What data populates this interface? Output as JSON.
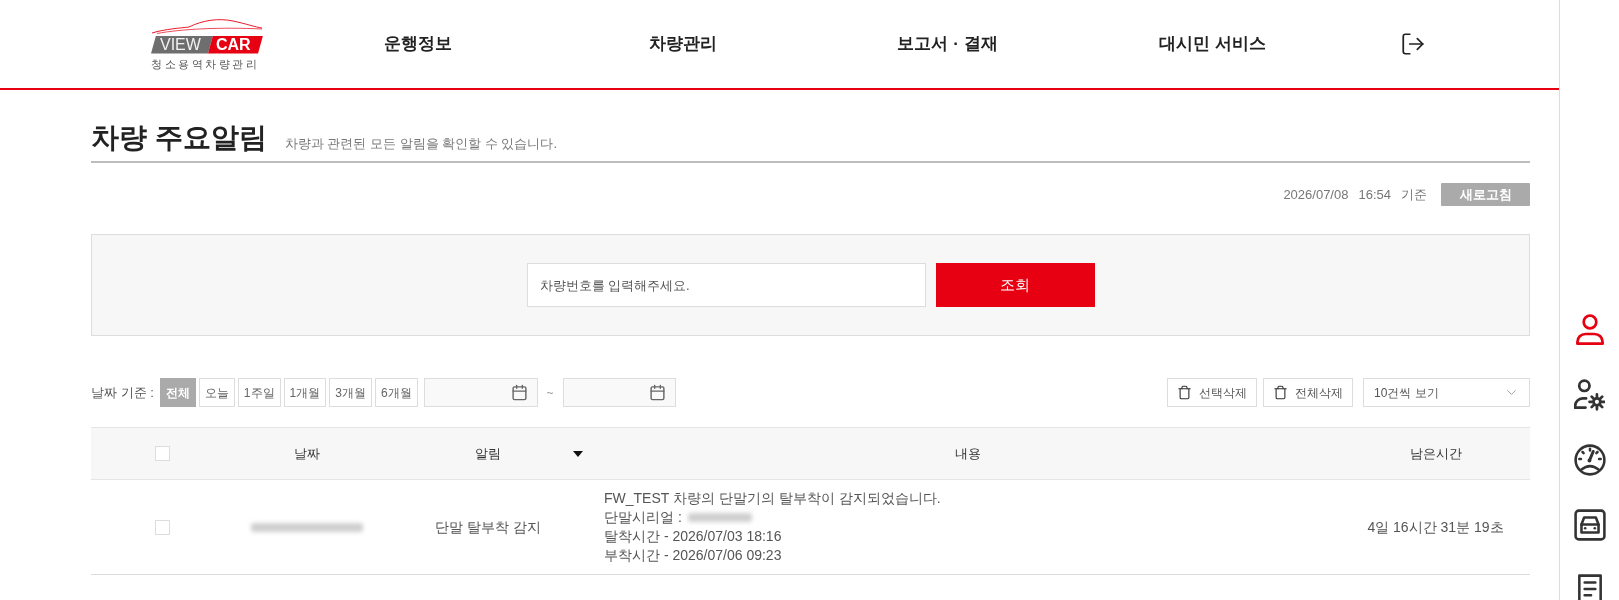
{
  "header": {
    "logo": {
      "word_left": "VIEW",
      "word_right": "CAR",
      "subtitle": "청소용역차량관리"
    },
    "nav": [
      "운행정보",
      "차량관리",
      "보고서 · 결재",
      "대시민 서비스"
    ]
  },
  "page": {
    "title": "차량 주요알림",
    "description": "차량과 관련된 모든 알림을 확인할 수 있습니다."
  },
  "timestamp": {
    "date": "2026/07/08",
    "time": "16:54",
    "suffix": "기준",
    "refresh_button": "새로고침"
  },
  "search": {
    "placeholder": "차량번호를 입력해주세요.",
    "button": "조회"
  },
  "filters": {
    "label": "날짜 기준 :",
    "periods": [
      {
        "label": "전체",
        "selected": true
      },
      {
        "label": "오늘",
        "selected": false
      },
      {
        "label": "1주일",
        "selected": false
      },
      {
        "label": "1개월",
        "selected": false
      },
      {
        "label": "3개월",
        "selected": false
      },
      {
        "label": "6개월",
        "selected": false
      }
    ],
    "range_separator": "~"
  },
  "actions": [
    "선택삭제",
    "전체삭제"
  ],
  "page_size": "10건씩 보기",
  "table": {
    "select_all": {
      "checked": false
    },
    "columns": [
      {
        "label": "날짜"
      },
      {
        "label": "알림",
        "sortable": true
      },
      {
        "label": "내용"
      },
      {
        "label": "남은시간"
      }
    ],
    "rows": [
      {
        "checked": false,
        "date_blurred": true,
        "alert": "단말 탈부착 감지",
        "message": "FW_TEST 차량의 단말기의 탈부착이 감지되었습니다.",
        "serial_label": "단말시리얼 :",
        "serial_blurred": true,
        "details": [
          "탈착시간 - 2026/07/03 18:16",
          "부착시간 - 2026/07/06 09:23"
        ],
        "remaining": "4일 16시간 31분 19초"
      }
    ]
  },
  "side_menu": [
    {
      "selected": true
    },
    {
      "selected": false
    },
    {
      "selected": false
    },
    {
      "selected": false
    },
    {
      "selected": false
    }
  ]
}
